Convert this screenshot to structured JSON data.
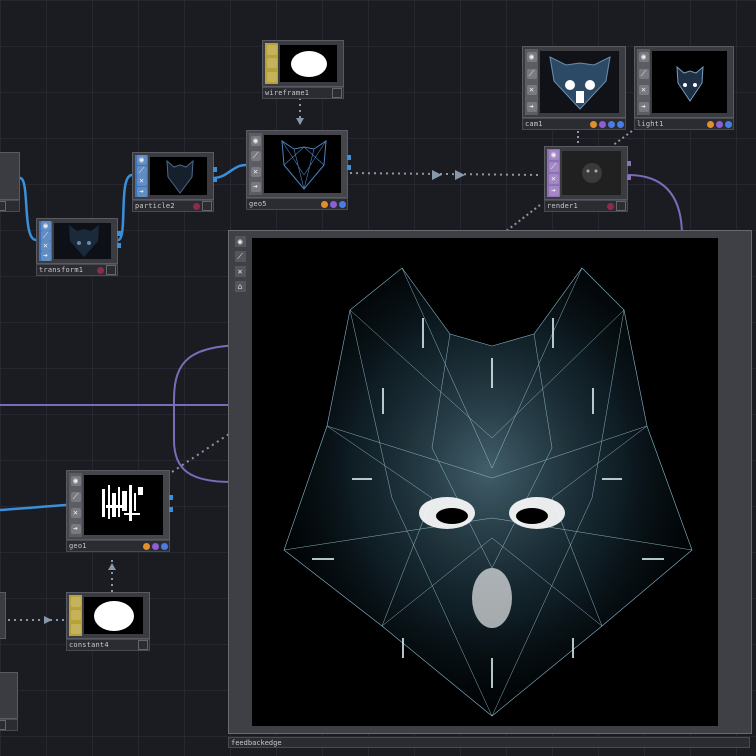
{
  "network": {
    "nodes": [
      {
        "id": "wireframe1",
        "label": "wireframe1",
        "family": "chop",
        "flags": [
          "#bbbbbb"
        ]
      },
      {
        "id": "cam1",
        "label": "cam1",
        "family": "obj",
        "flags": [
          "#e0902a",
          "#8b5fd6",
          "#4b7de0",
          "#4b7de0"
        ]
      },
      {
        "id": "light1",
        "label": "light1",
        "family": "obj",
        "flags": [
          "#e0902a",
          "#8b5fd6",
          "#4b7de0"
        ]
      },
      {
        "id": "particle2",
        "label": "particle2",
        "family": "sop",
        "flags": [
          "#8a2d4a",
          "#666666"
        ]
      },
      {
        "id": "geo5",
        "label": "geo5",
        "family": "sop",
        "flags": [
          "#e0902a",
          "#8b5fd6",
          "#4b7de0"
        ]
      },
      {
        "id": "render1",
        "label": "render1",
        "family": "comp",
        "flags": [
          "#8a2d4a",
          "#666666"
        ]
      },
      {
        "id": "transform1",
        "label": "transform1",
        "family": "sop",
        "flags": [
          "#8a2d4a",
          "#666666"
        ]
      },
      {
        "id": "geo1",
        "label": "geo1",
        "family": "sop",
        "flags": [
          "#e0902a",
          "#8b5fd6",
          "#4b7de0"
        ]
      },
      {
        "id": "constant4",
        "label": "constant4",
        "family": "chop",
        "flags": [
          "#bbbbbb"
        ]
      }
    ],
    "viewer": {
      "label": "feedbackedge"
    },
    "side_icons": [
      "◉",
      "⟋",
      "✕",
      "➔",
      "⌂"
    ]
  }
}
